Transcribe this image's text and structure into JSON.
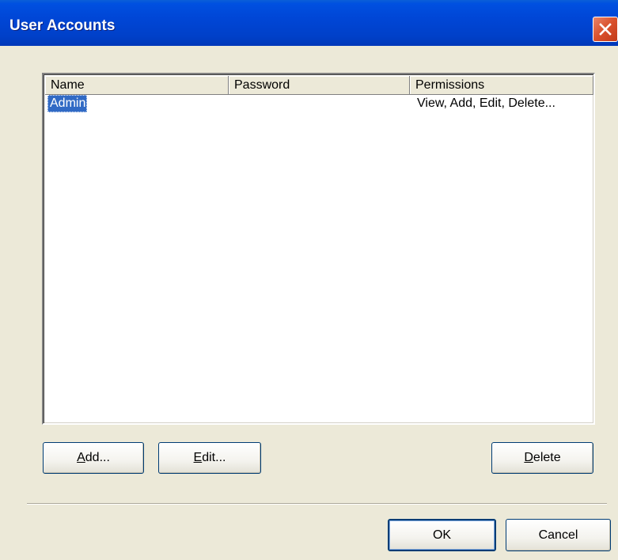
{
  "dialog": {
    "title": "User Accounts"
  },
  "list": {
    "columns": [
      "Name",
      "Password",
      "Permissions"
    ],
    "rows": [
      {
        "name": "Admin",
        "password": "",
        "permissions": "View, Add, Edit, Delete...",
        "selected": true
      }
    ]
  },
  "buttons": {
    "add": {
      "accel": "A",
      "rest": "dd..."
    },
    "edit": {
      "accel": "E",
      "rest": "dit..."
    },
    "delete": {
      "accel": "D",
      "rest": "elete"
    },
    "ok": "OK",
    "cancel": "Cancel"
  },
  "colors": {
    "titlebar": "#0046d6",
    "face": "#ece9d8",
    "selection": "#316ac5",
    "close": "#d9502c"
  }
}
